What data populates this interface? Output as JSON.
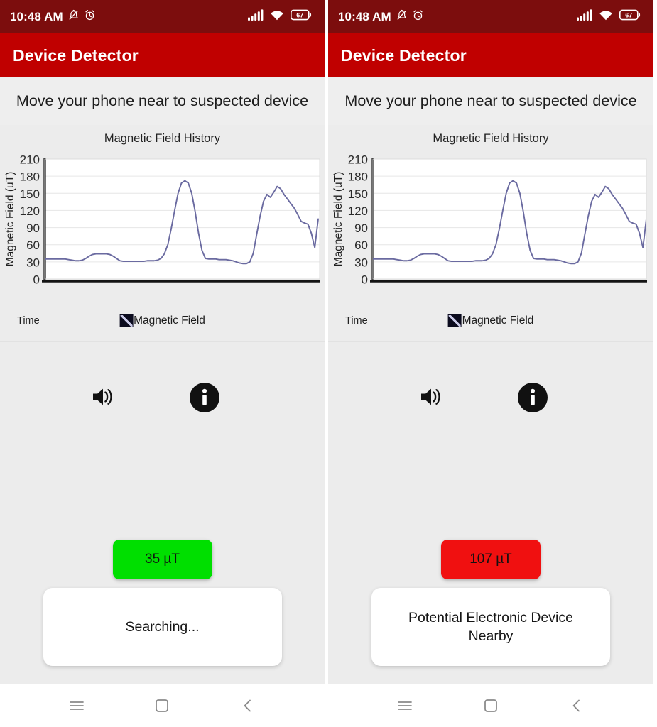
{
  "app": {
    "title": "Device Detector",
    "prompt": "Move your phone near to suspected device",
    "appbar_color": "#c00000",
    "statusbar_color": "#7c0d0d",
    "background_color": "#ececec"
  },
  "status_bar": {
    "time": "10:48 AM",
    "battery_percent": "67",
    "icons": [
      "silent-bell-icon",
      "alarm-clock-icon",
      "signal-bars-icon",
      "wifi-icon",
      "battery-icon"
    ]
  },
  "chart_data": {
    "type": "line",
    "title": "Magnetic Field History",
    "xlabel": "Time",
    "ylabel": "Magnetic Field (uT)",
    "ylim": [
      0,
      210
    ],
    "yticks": [
      0,
      30,
      60,
      90,
      120,
      150,
      180,
      210
    ],
    "xticks": [],
    "grid": true,
    "legend": [
      {
        "name": "Magnetic Field",
        "color": "#6a6aa0"
      }
    ],
    "legend_position": "below-center",
    "series": [
      {
        "name": "Magnetic Field",
        "color": "#6a6aa0",
        "x": [
          0,
          1,
          2,
          3,
          4,
          5,
          6,
          7,
          8,
          9,
          10,
          11,
          12,
          13,
          14,
          15,
          16,
          17,
          18,
          19,
          20,
          21,
          22,
          23,
          24,
          25,
          26,
          27,
          28,
          29,
          30,
          31,
          32,
          33,
          34,
          35,
          36,
          37,
          38,
          39,
          40,
          41,
          42,
          43,
          44,
          45,
          46,
          47,
          48,
          49,
          50,
          51,
          52,
          53,
          54,
          55,
          56,
          57,
          58,
          59,
          60,
          61,
          62,
          63,
          64,
          65,
          66,
          67,
          68,
          69,
          70,
          71,
          72,
          73,
          74,
          75,
          76,
          77,
          78,
          79,
          80
        ],
        "values": [
          35,
          35,
          35,
          35,
          35,
          35,
          35,
          34,
          33,
          32,
          32,
          33,
          36,
          40,
          43,
          44,
          44,
          44,
          44,
          43,
          40,
          36,
          32,
          31,
          31,
          31,
          31,
          31,
          31,
          31,
          32,
          32,
          32,
          33,
          36,
          44,
          60,
          88,
          120,
          150,
          168,
          172,
          168,
          150,
          118,
          80,
          50,
          36,
          35,
          35,
          35,
          34,
          34,
          34,
          33,
          32,
          30,
          28,
          27,
          27,
          30,
          45,
          78,
          110,
          136,
          148,
          143,
          152,
          162,
          158,
          148,
          140,
          132,
          124,
          113,
          101,
          98,
          96,
          80,
          55,
          105
        ]
      }
    ]
  },
  "controls": {
    "speaker": {
      "name": "Sound toggle",
      "icon": "speaker-icon"
    },
    "info": {
      "name": "Information",
      "icon": "info-icon"
    }
  },
  "panels": [
    {
      "id": "left",
      "reading": "35 µT",
      "reading_color": "#00df00",
      "status_message": "Searching..."
    },
    {
      "id": "right",
      "reading": "107 µT",
      "reading_color": "#f01010",
      "status_message": "Potential Electronic Device Nearby"
    }
  ],
  "nav_bar": {
    "recents_label": "Recents",
    "home_label": "Home",
    "back_label": "Back",
    "icons": [
      "menu-icon",
      "square-icon",
      "chevron-left-icon"
    ]
  }
}
